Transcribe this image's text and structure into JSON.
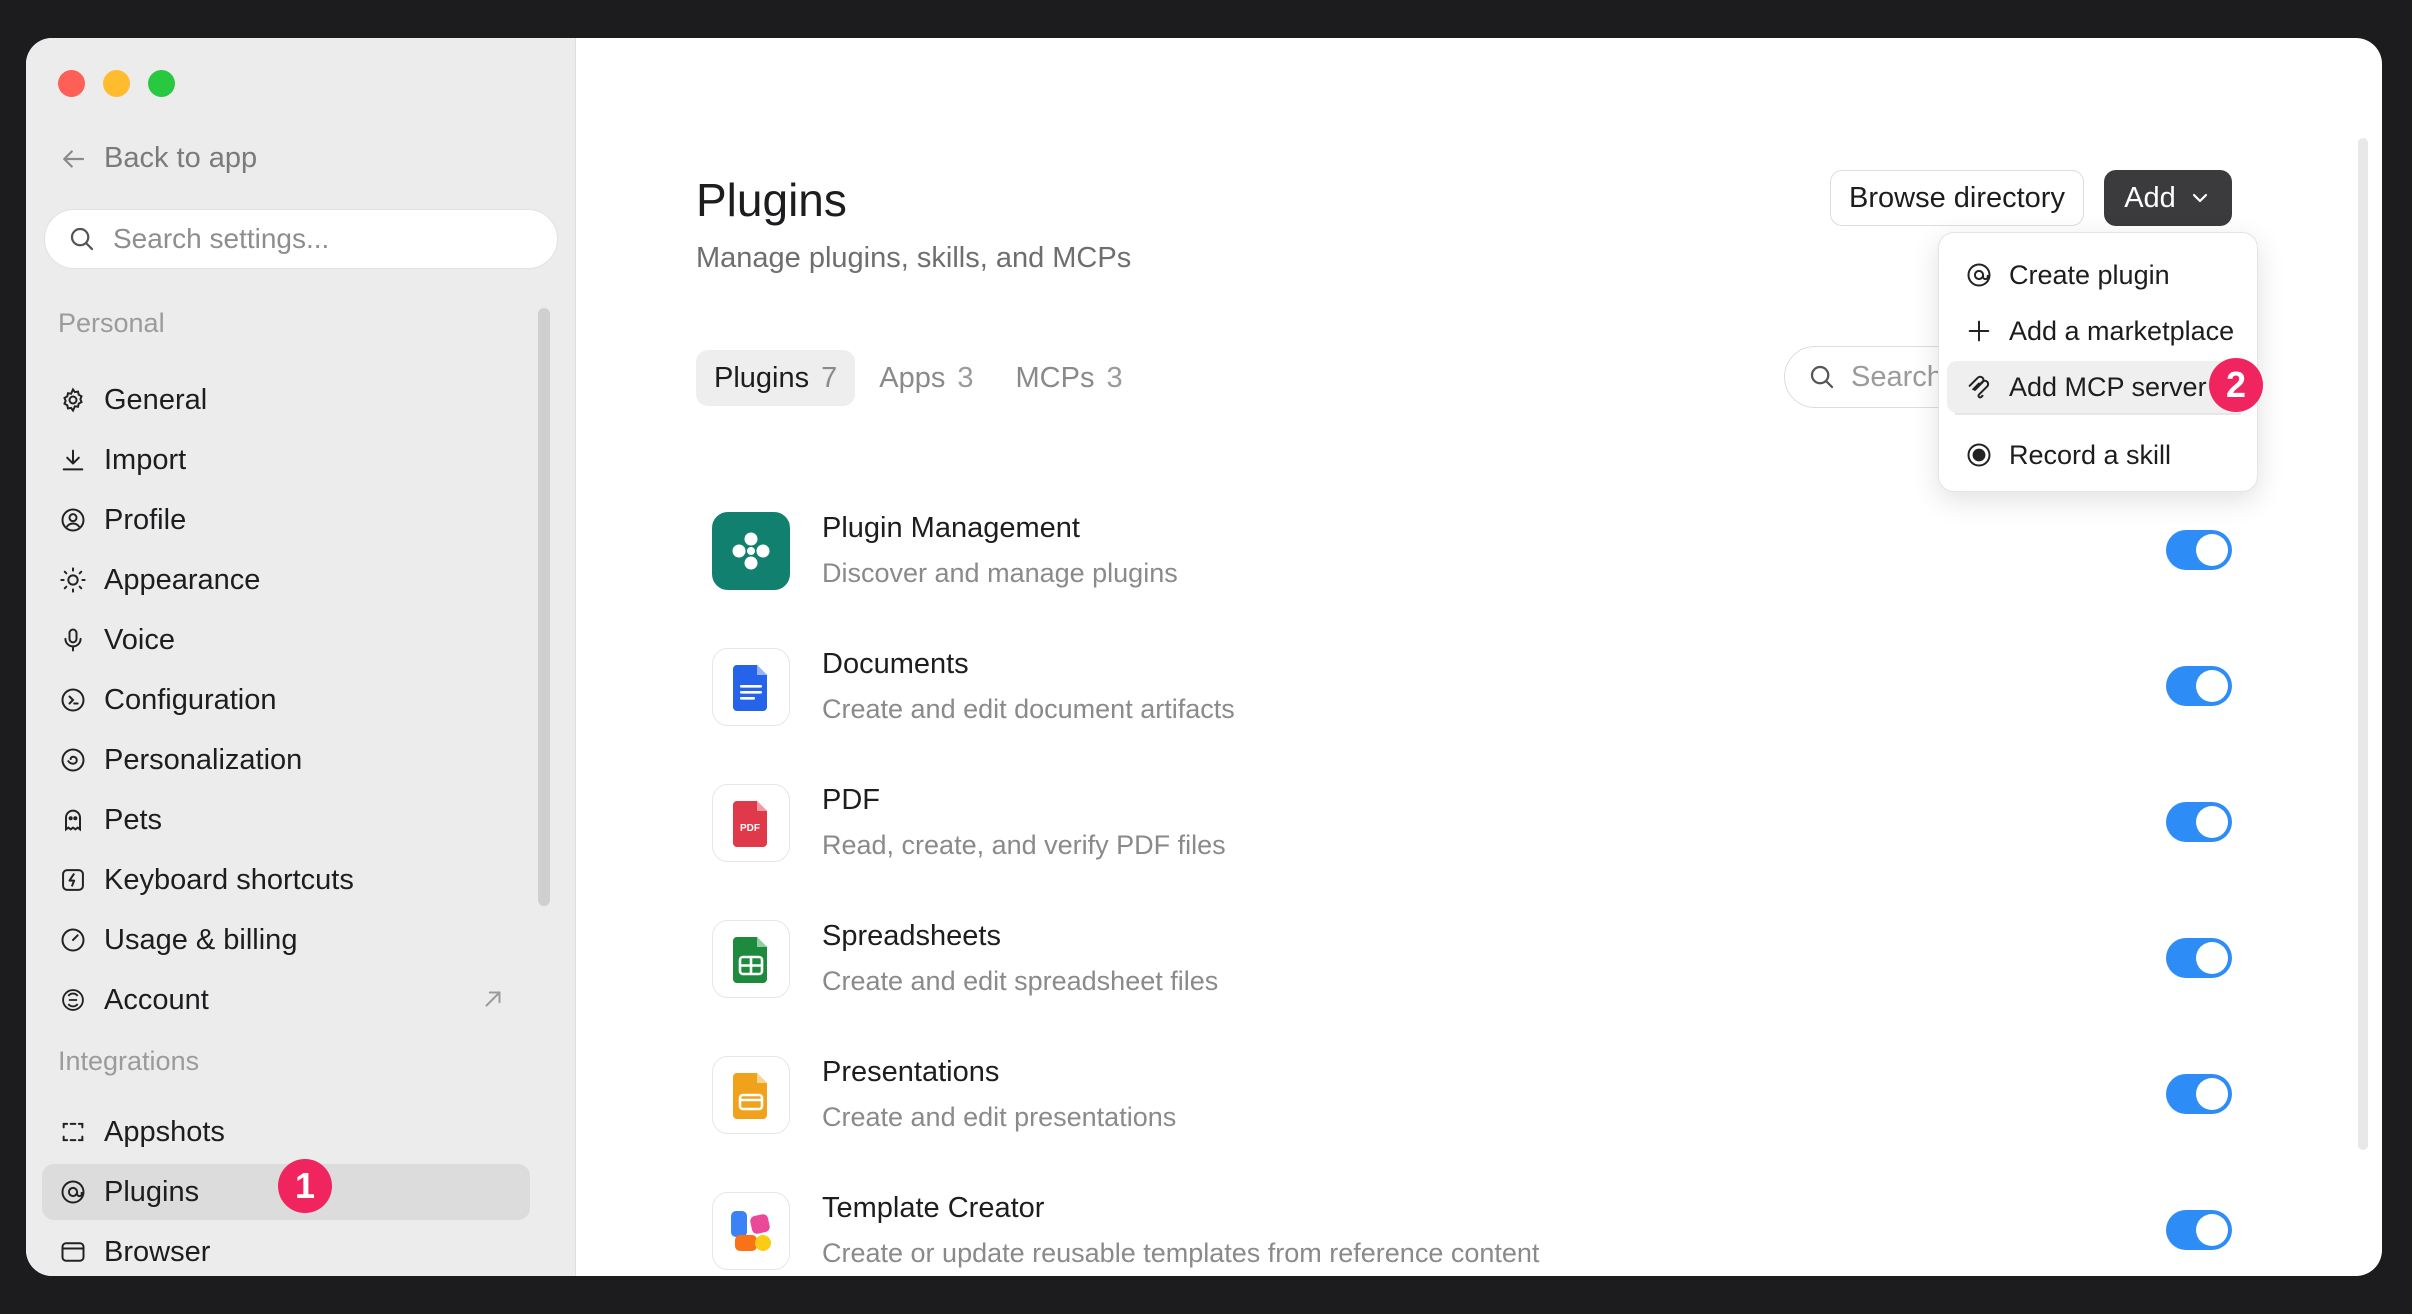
{
  "sidebar": {
    "back_label": "Back to app",
    "search_placeholder": "Search settings...",
    "personal_title": "Personal",
    "personal_items": [
      {
        "label": "General",
        "icon": "gear-icon"
      },
      {
        "label": "Import",
        "icon": "download-icon"
      },
      {
        "label": "Profile",
        "icon": "user-circle-icon"
      },
      {
        "label": "Appearance",
        "icon": "sun-icon"
      },
      {
        "label": "Voice",
        "icon": "microphone-icon"
      },
      {
        "label": "Configuration",
        "icon": "configuration-icon"
      },
      {
        "label": "Personalization",
        "icon": "personalization-icon"
      },
      {
        "label": "Pets",
        "icon": "pet-icon"
      },
      {
        "label": "Keyboard shortcuts",
        "icon": "keyboard-bolt-icon"
      },
      {
        "label": "Usage & billing",
        "icon": "gauge-icon"
      },
      {
        "label": "Account",
        "icon": "account-icon"
      }
    ],
    "integrations_title": "Integrations",
    "integration_items": [
      {
        "label": "Appshots",
        "icon": "screenshot-frame-icon"
      },
      {
        "label": "Plugins",
        "icon": "plugin-icon",
        "active": true
      },
      {
        "label": "Browser",
        "icon": "browser-icon"
      }
    ]
  },
  "annotations": {
    "badge1": "1",
    "badge2": "2",
    "color": "#f0245e"
  },
  "main": {
    "title": "Plugins",
    "subtitle": "Manage plugins, skills, and MCPs",
    "browse_label": "Browse directory",
    "add_label": "Add",
    "search_placeholder": "Search",
    "tabs": [
      {
        "label": "Plugins",
        "count": "7",
        "active": true
      },
      {
        "label": "Apps",
        "count": "3"
      },
      {
        "label": "MCPs",
        "count": "3"
      }
    ],
    "plugins": [
      {
        "name": "Plugin Management",
        "description": "Discover and manage plugins",
        "enabled": true
      },
      {
        "name": "Documents",
        "description": "Create and edit document artifacts",
        "enabled": true
      },
      {
        "name": "PDF",
        "description": "Read, create, and verify PDF files",
        "enabled": true,
        "icon_text": "PDF"
      },
      {
        "name": "Spreadsheets",
        "description": "Create and edit spreadsheet files",
        "enabled": true
      },
      {
        "name": "Presentations",
        "description": "Create and edit presentations",
        "enabled": true
      },
      {
        "name": "Template Creator",
        "description": "Create or update reusable templates from reference content",
        "enabled": true
      }
    ]
  },
  "add_menu": {
    "items": [
      {
        "label": "Create plugin",
        "icon": "plugin-icon"
      },
      {
        "label": "Add a marketplace",
        "icon": "plus-icon"
      },
      {
        "label": "Add MCP server",
        "icon": "mcp-icon",
        "highlighted": true
      },
      {
        "label": "Record a skill",
        "icon": "record-icon"
      }
    ]
  },
  "colors": {
    "accent": "#2e8cf6",
    "add_button": "#3b3b3d"
  }
}
